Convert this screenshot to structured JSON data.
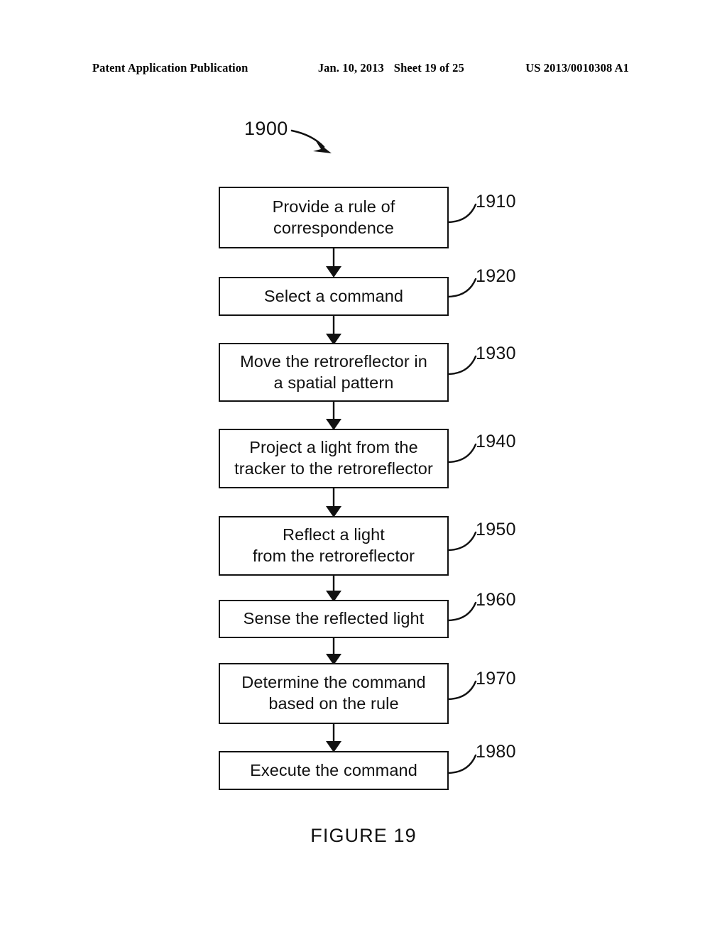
{
  "header": {
    "left": "Patent Application Publication",
    "date": "Jan. 10, 2013",
    "sheet": "Sheet 19 of 25",
    "publication_number": "US 2013/0010308 A1"
  },
  "figure": {
    "caption": "FIGURE 19",
    "callout_label": "1900",
    "steps": [
      {
        "id": "1910",
        "text": "Provide a rule of\ncorrespondence"
      },
      {
        "id": "1920",
        "text": "Select a command"
      },
      {
        "id": "1930",
        "text": "Move the retroreflector in\na spatial pattern"
      },
      {
        "id": "1940",
        "text": "Project a light from the\ntracker to the retroreflector"
      },
      {
        "id": "1950",
        "text": "Reflect a light\nfrom the retroreflector"
      },
      {
        "id": "1960",
        "text": "Sense the reflected light"
      },
      {
        "id": "1970",
        "text": "Determine the command\nbased on the rule"
      },
      {
        "id": "1980",
        "text": "Execute the command"
      }
    ]
  },
  "colors": {
    "ink": "#111111",
    "paper": "#ffffff"
  }
}
